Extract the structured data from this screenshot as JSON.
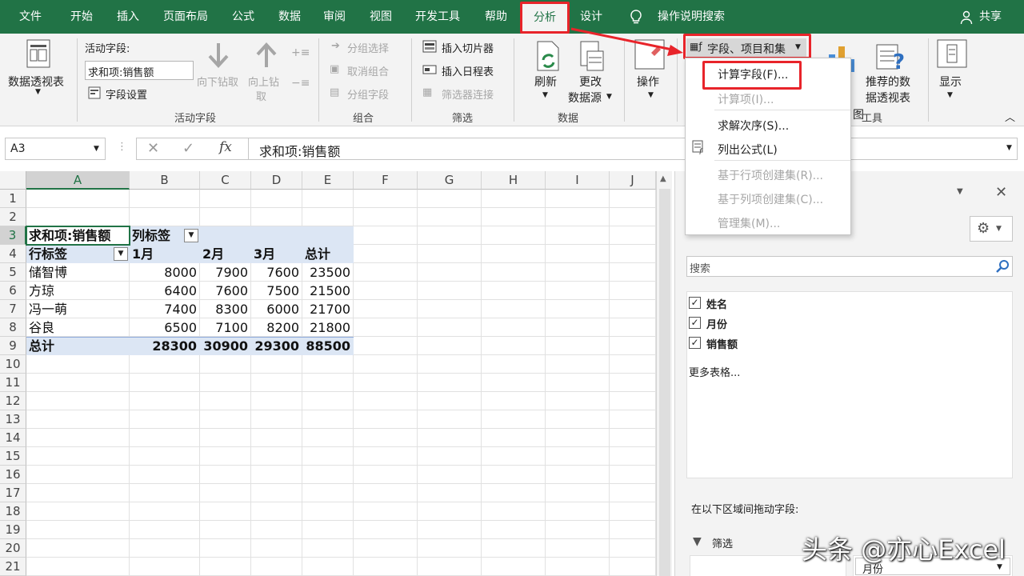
{
  "tabs": {
    "file": "文件",
    "home": "开始",
    "insert": "插入",
    "layout": "页面布局",
    "formulas": "公式",
    "data": "数据",
    "review": "审阅",
    "view": "视图",
    "developer": "开发工具",
    "help": "帮助",
    "analyze": "分析",
    "design": "设计",
    "tell": "操作说明搜索",
    "share": "共享"
  },
  "ribbon": {
    "pivot_table": "数据透视表",
    "active_field_label": "活动字段:",
    "active_field_value": "求和项:销售额",
    "field_settings": "字段设置",
    "drill_down": "向下钻取",
    "drill_up": "向上钻",
    "drill_up2": "取",
    "group_active_field": "活动字段",
    "group_selection": "分组选择",
    "ungroup": "取消组合",
    "group_field": "分组字段",
    "group_group": "组合",
    "insert_slicer": "插入切片器",
    "insert_timeline": "插入日程表",
    "filter_connections": "筛选器连接",
    "group_filter": "筛选",
    "refresh": "刷新",
    "change_source": "更改",
    "change_source2": "数据源",
    "group_data": "数据",
    "actions": "操作",
    "fields_items_sets": "字段、项目和集",
    "recommended": "推荐的数",
    "recommended2": "据透视表",
    "tools_partial1": "图",
    "group_tools": "工具",
    "show": "显示"
  },
  "menu": {
    "calc_field": "计算字段(F)...",
    "calc_item": "计算项(I)...",
    "solve_order": "求解次序(S)...",
    "list_formulas": "列出公式(L)",
    "row_set": "基于行项创建集(R)...",
    "col_set": "基于列项创建集(C)...",
    "manage_sets": "管理集(M)..."
  },
  "formula_bar": {
    "name_box": "A3",
    "formula": "求和项:销售额",
    "fx": "fx"
  },
  "grid": {
    "columns": [
      "A",
      "B",
      "C",
      "D",
      "E",
      "F",
      "G",
      "H",
      "I",
      "J"
    ],
    "rows": [
      "1",
      "2",
      "3",
      "4",
      "5",
      "6",
      "7",
      "8",
      "9",
      "10",
      "11",
      "12",
      "13",
      "14",
      "15",
      "16",
      "17",
      "18",
      "19",
      "20",
      "21"
    ],
    "pivot": {
      "value_label": "求和项:销售额",
      "col_labels": "列标签",
      "row_labels": "行标签",
      "months": [
        "1月",
        "2月",
        "3月"
      ],
      "total_header": "总计",
      "data": [
        {
          "name": "储智博",
          "v": [
            "8000",
            "7900",
            "7600",
            "23500"
          ]
        },
        {
          "name": "方琼",
          "v": [
            "6400",
            "7600",
            "7500",
            "21500"
          ]
        },
        {
          "name": "冯一萌",
          "v": [
            "7400",
            "8300",
            "6000",
            "21700"
          ]
        },
        {
          "name": "谷良",
          "v": [
            "6500",
            "7100",
            "8200",
            "21800"
          ]
        }
      ],
      "total_label": "总计",
      "totals": [
        "28300",
        "30900",
        "29300",
        "88500"
      ]
    }
  },
  "pane": {
    "search_placeholder": "搜索",
    "fields": [
      {
        "name": "姓名",
        "checked": true
      },
      {
        "name": "月份",
        "checked": true
      },
      {
        "name": "销售额",
        "checked": true
      }
    ],
    "more_tables": "更多表格...",
    "drag_hint": "在以下区域间拖动字段:",
    "filter_area": "筛选",
    "col_field": "月份"
  },
  "watermark": "头条 @亦心Excel",
  "colors": {
    "excel_green": "#217346",
    "highlight_red": "#e8242a",
    "pivot_header": "#dce6f4"
  }
}
